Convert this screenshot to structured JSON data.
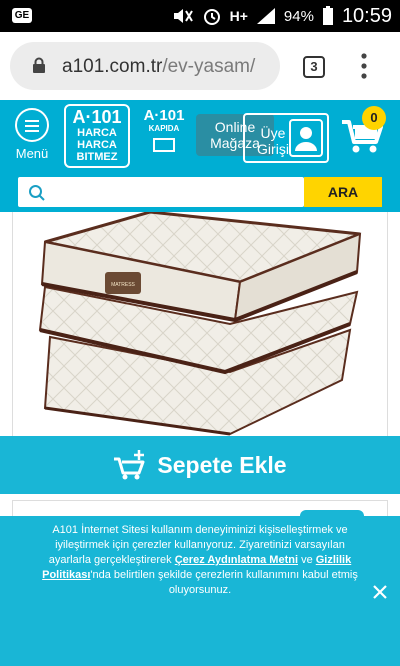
{
  "statusbar": {
    "left_badge": "GE",
    "signal_label": "H+",
    "battery": "94%",
    "time": "10:59"
  },
  "browser": {
    "url_host": "a101.com.tr",
    "url_path": "/ev-yasam/",
    "tab_count": "3"
  },
  "header": {
    "menu_label": "Menü",
    "logo1_line1": "A·101",
    "logo1_line2": "HARCA",
    "logo1_line3": "HARCA",
    "logo1_line4": "BITMEZ",
    "logo2_line1": "A·101",
    "logo2_line2": "KAPIDA",
    "online_label": "Online Mağaza",
    "login_label": "Üye Girişi",
    "cart_count": "0"
  },
  "search": {
    "placeholder": "",
    "button_label": "ARA"
  },
  "product": {
    "label_tag": "MATRESS"
  },
  "cart_button": {
    "label": "Sepete Ekle"
  },
  "cookie": {
    "text_part1": "A101 İnternet Sitesi kullanım deneyiminizi kişiselleştirmek ve iyileştirmek için çerezler kullanıyoruz. Ziyaretinizi varsayılan ayarlarla gerçekleştirerek",
    "link1": "Çerez Aydınlatma Metni",
    "text_and": " ve ",
    "link2": "Gizlilik Politikası",
    "text_part2": "'nda belirtilen şekilde çerezlerin kullanımını kabul etmiş oluyorsunuz."
  },
  "colors": {
    "brand_teal": "#00aed3",
    "accent_yellow": "#ffd400"
  }
}
